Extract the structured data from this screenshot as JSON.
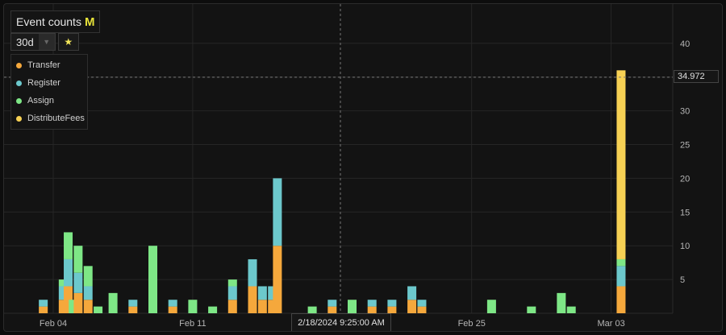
{
  "header": {
    "title": "Event counts",
    "badge": "M"
  },
  "controls": {
    "range_value": "30d",
    "caret_icon": "chevron-down-icon",
    "star_icon": "star-icon"
  },
  "crosshair": {
    "x_label": "2/18/2024 9:25:00 AM",
    "y_label": "34.972"
  },
  "colors": {
    "Transfer": "#f5a83c",
    "Register": "#6cc8cc",
    "Assign": "#7ee786",
    "DistributeFees": "#f7d154"
  },
  "chart_data": {
    "type": "bar",
    "stacked": true,
    "title": "Event counts",
    "ylim": [
      0,
      45
    ],
    "yticks": [
      5,
      10,
      15,
      20,
      25,
      30,
      35,
      40
    ],
    "xticks": [
      {
        "day": 3,
        "label": "Feb 04"
      },
      {
        "day": 10,
        "label": "Feb 11"
      },
      {
        "day": 24,
        "label": "Feb 25"
      },
      {
        "day": 31,
        "label": "Mar 03"
      }
    ],
    "grid": true,
    "legend_position": "top-left",
    "x": [
      "Feb 03 12:00",
      "Feb 04 12:00",
      "Feb 04 18:00",
      "Feb 05 00:00",
      "Feb 05 06:00",
      "Feb 05 12:00",
      "Feb 05 18:00",
      "Feb 06 06:00",
      "Feb 07 00:00",
      "Feb 08 00:00",
      "Feb 09 00:00",
      "Feb 10 00:00",
      "Feb 11 00:00",
      "Feb 12 00:00",
      "Feb 13 00:00",
      "Feb 14 00:00",
      "Feb 14 12:00",
      "Feb 14 18:00",
      "Feb 15 00:00",
      "Feb 15 06:00",
      "Feb 17 00:00",
      "Feb 18 00:00",
      "Feb 19 00:00",
      "Feb 20 00:00",
      "Feb 21 00:00",
      "Feb 22 00:00",
      "Feb 22 12:00",
      "Feb 23 12:00",
      "Feb 26 00:00",
      "Feb 28 00:00",
      "Feb 29 12:00",
      "Mar 01 00:00",
      "Mar 01 12:00",
      "Mar 02 00:00",
      "Mar 03 12:00"
    ],
    "series": [
      {
        "name": "Transfer",
        "values": [
          1,
          2,
          4,
          0,
          3,
          0,
          2,
          0,
          0,
          1,
          0,
          1,
          0,
          0,
          2,
          4,
          2,
          0,
          2,
          10,
          0,
          1,
          0,
          1,
          1,
          2,
          1,
          0,
          0,
          0,
          0,
          0,
          0,
          0,
          4
        ]
      },
      {
        "name": "Register",
        "values": [
          1,
          2,
          4,
          0,
          3,
          0,
          2,
          0,
          0,
          1,
          0,
          1,
          0,
          0,
          2,
          4,
          2,
          0,
          2,
          10,
          0,
          1,
          0,
          1,
          1,
          2,
          1,
          0,
          0,
          0,
          0,
          0,
          0,
          0,
          3
        ]
      },
      {
        "name": "Assign",
        "values": [
          0,
          1,
          4,
          2,
          4,
          0,
          3,
          1,
          3,
          0,
          10,
          0,
          2,
          1,
          1,
          0,
          0,
          0,
          0,
          0,
          1,
          0,
          2,
          0,
          0,
          0,
          0,
          0,
          2,
          1,
          3,
          1,
          0,
          0,
          1
        ]
      },
      {
        "name": "DistributeFees",
        "values": [
          0,
          0,
          0,
          0,
          0,
          0,
          0,
          0,
          0,
          0,
          0,
          0,
          0,
          0,
          0,
          0,
          0,
          0,
          0,
          0,
          0,
          0,
          0,
          0,
          0,
          0,
          0,
          0,
          0,
          0,
          0,
          0,
          0,
          0,
          28
        ]
      }
    ],
    "x_days": [
      2.5,
      3.5,
      3.75,
      4,
      4.25,
      4.5,
      4.75,
      5.25,
      6,
      7,
      8,
      9,
      10,
      11,
      12,
      13,
      13.5,
      13.75,
      14,
      14.25,
      16,
      17,
      18,
      19,
      20,
      21,
      21.5,
      22.5,
      25,
      27,
      28.5,
      29,
      29.5,
      30,
      31.5
    ]
  }
}
